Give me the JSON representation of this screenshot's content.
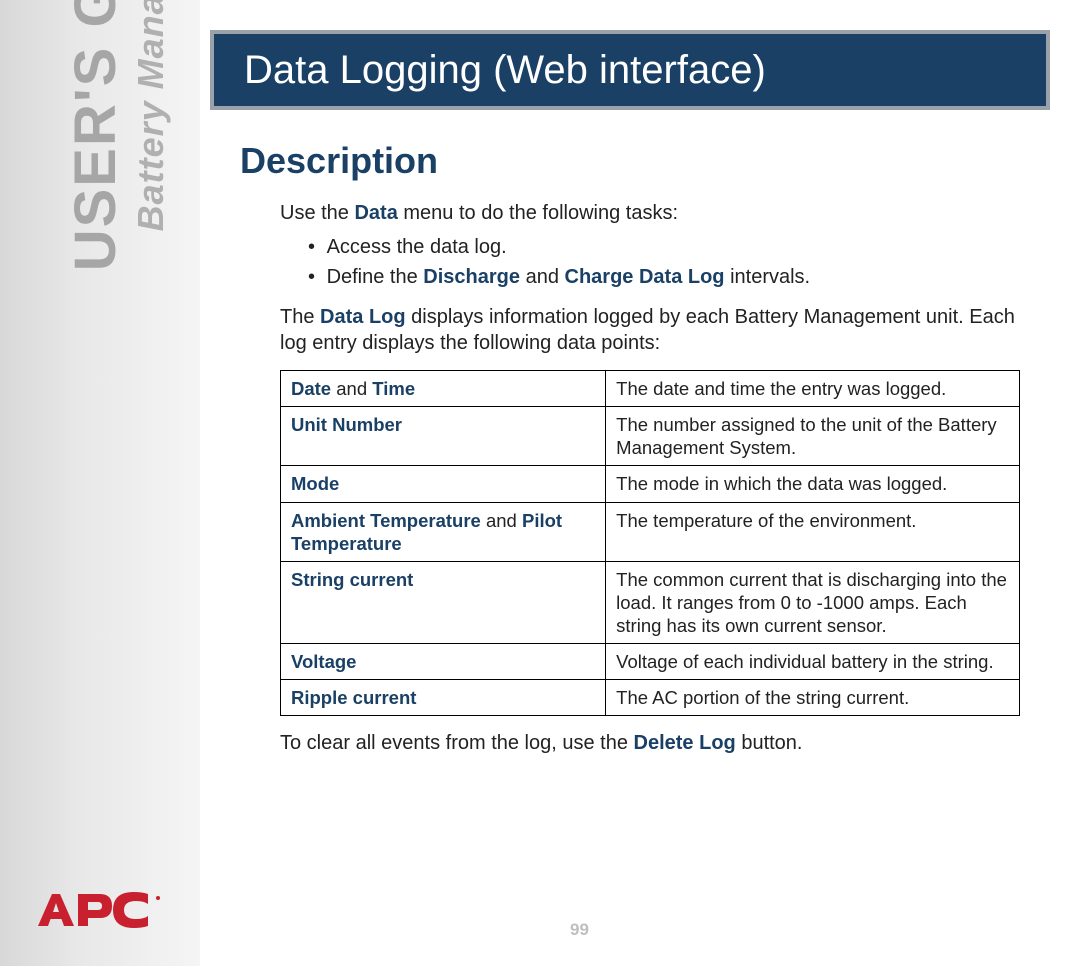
{
  "sidebar": {
    "main_label": "USER'S GUIDE",
    "sub_label": "Battery Management System"
  },
  "logo": {
    "text": "APC"
  },
  "title": "Data Logging (Web interface)",
  "section_heading": "Description",
  "intro": {
    "lead": "Use the ",
    "menu_name": "Data",
    "lead_tail": " menu to do the following tasks:",
    "bullets": [
      {
        "text": "Access the data log."
      },
      {
        "prefix": "Define the ",
        "b1": "Discharge",
        "mid": " and ",
        "b2": "Charge Data Log",
        "suffix": " intervals."
      }
    ],
    "para2_pre": "The ",
    "para2_b": "Data Log",
    "para2_post": " displays information logged by each Battery Management unit. Each log entry displays the following data points:"
  },
  "table": [
    {
      "term_parts": [
        "Date",
        " and ",
        "Time"
      ],
      "def": "The date and time the entry was logged."
    },
    {
      "term_parts": [
        "Unit Number"
      ],
      "def": "The number assigned to the unit of the Battery Management System."
    },
    {
      "term_parts": [
        "Mode"
      ],
      "def": "The mode in which the data was logged."
    },
    {
      "term_parts": [
        "Ambient Temperature",
        " and ",
        "Pilot Temperature"
      ],
      "def": "The temperature of the environment."
    },
    {
      "term_parts": [
        "String current"
      ],
      "def": "The common current that is discharging into the load. It ranges from 0 to -1000 amps. Each string has its own current sensor."
    },
    {
      "term_parts": [
        "Voltage"
      ],
      "def": "Voltage of each individual battery in the string."
    },
    {
      "term_parts": [
        "Ripple current"
      ],
      "def": "The AC portion of the string current."
    }
  ],
  "closing": {
    "pre": "To clear all events from the log, use the ",
    "b": "Delete Log",
    "post": " button."
  },
  "page_number": "99"
}
